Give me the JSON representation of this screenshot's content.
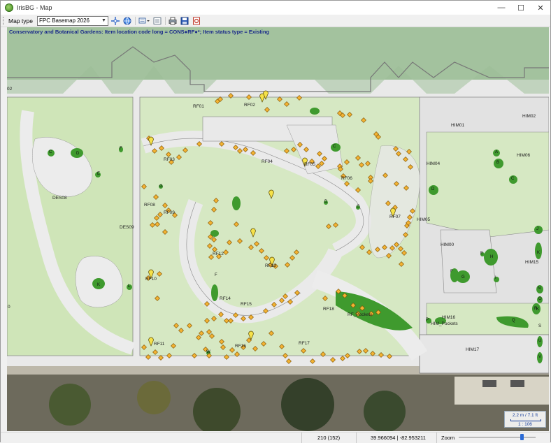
{
  "window": {
    "title": "IrisBG - Map",
    "btn_min": "—",
    "btn_max": "☐",
    "btn_close": "✕"
  },
  "toolbar": {
    "map_type_label": "Map type",
    "map_type_value": "FPC Basemap 2026",
    "icons": [
      "pan-select-icon",
      "globe-icon",
      "layers-dropdown-icon",
      "list-icon",
      "print-icon",
      "save-icon",
      "export-icon"
    ]
  },
  "map": {
    "caption": "Conservatory and Botanical Gardens: Item location code long = CONS●RF●*; Item status type = Existing",
    "zones": [
      {
        "id": "RF01",
        "text": "RF01"
      },
      {
        "id": "RF02",
        "text": "RF02"
      },
      {
        "id": "RF03",
        "text": "RF03"
      },
      {
        "id": "RF04",
        "text": "RF04"
      },
      {
        "id": "RF05",
        "text": "RF05"
      },
      {
        "id": "RF06",
        "text": "RF06"
      },
      {
        "id": "RF07",
        "text": "RF07"
      },
      {
        "id": "RF08",
        "text": "RF08"
      },
      {
        "id": "RF09",
        "text": "RF09"
      },
      {
        "id": "RF10",
        "text": "RF10"
      },
      {
        "id": "RF11",
        "text": "RF11"
      },
      {
        "id": "RF12",
        "text": "RF12"
      },
      {
        "id": "RF13",
        "text": "RF13"
      },
      {
        "id": "RF14",
        "text": "RF14"
      },
      {
        "id": "RF15",
        "text": "RF15"
      },
      {
        "id": "RF16",
        "text": "RF16"
      },
      {
        "id": "RF17",
        "text": "RF17"
      },
      {
        "id": "RF18",
        "text": "RF18"
      },
      {
        "id": "RFP",
        "text": "RF_Pockets"
      },
      {
        "id": "DES08",
        "text": "DES08"
      },
      {
        "id": "DES09",
        "text": "DES09"
      },
      {
        "id": "HIM00",
        "text": "HIM00"
      },
      {
        "id": "HIM01",
        "text": "HIM01"
      },
      {
        "id": "HIM02",
        "text": "HIM02"
      },
      {
        "id": "HIM04",
        "text": "HIM04"
      },
      {
        "id": "HIM05",
        "text": "HIM05"
      },
      {
        "id": "HIM06",
        "text": "HIM06"
      },
      {
        "id": "HIM15",
        "text": "HIM15"
      },
      {
        "id": "HIM16",
        "text": "HIM16"
      },
      {
        "id": "HIMP",
        "text": "HIM_Pockets"
      },
      {
        "id": "HIM17",
        "text": "HIM17"
      }
    ],
    "edge_labels": {
      "left_top": "02",
      "left_mid": "0"
    },
    "beds": [
      "C",
      "D",
      "E",
      "F",
      "G",
      "K",
      "L",
      "C",
      "D",
      "F",
      "G",
      "H",
      "I",
      "J",
      "K",
      "A",
      "B",
      "C",
      "D",
      "E",
      "F",
      "G",
      "H",
      "I",
      "J",
      "K",
      "L",
      "N",
      "O",
      "P",
      "Q",
      "R",
      "S",
      "U",
      "V",
      "W"
    ],
    "scale": {
      "distance": "2.2 m / 7.1 ft",
      "ratio": "1 : 106"
    }
  },
  "status": {
    "pixel": "210 (152)",
    "coords": "39.966094 | -82.953211",
    "zoom_label": "Zoom",
    "zoom_level": 0.82
  },
  "colors": {
    "lawn": "#cfe5b8",
    "path": "#e6e6e6",
    "bed": "#3f9a2e",
    "marker": "#f2b233",
    "pin": "#f5e14a",
    "caption": "#1a2a8a"
  }
}
